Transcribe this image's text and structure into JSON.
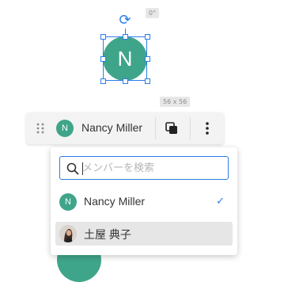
{
  "canvas": {
    "selected_avatar_initial": "N",
    "rotation_tag": "0°",
    "size_tag": "56 x 56"
  },
  "toolbar": {
    "member_initial": "N",
    "member_name": "Nancy Miller",
    "icons": [
      "drag-handle-icon",
      "copy-icon",
      "more-vertical-icon"
    ]
  },
  "dropdown": {
    "search_placeholder": "メンバーを検索",
    "options": [
      {
        "label": "Nancy Miller",
        "initial": "N",
        "selected": true
      },
      {
        "label": "土屋 典子",
        "initial": "",
        "selected": false,
        "photo": true
      }
    ]
  },
  "colors": {
    "accent": "#2b7de9",
    "avatar": "#3fa58a"
  }
}
